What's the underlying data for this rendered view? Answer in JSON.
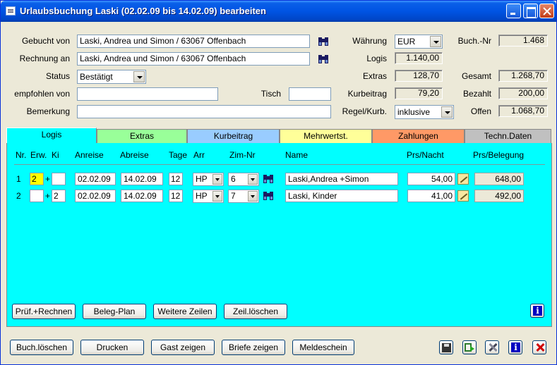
{
  "window": {
    "title": "Urlaubsbuchung Laski (02.02.09 bis 14.02.09) bearbeiten"
  },
  "form": {
    "gebucht_von_label": "Gebucht von",
    "gebucht_von_value": "Laski, Andrea und Simon / 63067 Offenbach",
    "rechnung_an_label": "Rechnung an",
    "rechnung_an_value": "Laski, Andrea und Simon / 63067 Offenbach",
    "status_label": "Status",
    "status_value": "Bestätigt",
    "empfohlen_label": "empfohlen von",
    "empfohlen_value": "",
    "tisch_label": "Tisch",
    "tisch_value": "",
    "bemerkung_label": "Bemerkung",
    "bemerkung_value": "",
    "waehrung_label": "Währung",
    "waehrung_value": "EUR",
    "logis_label": "Logis",
    "logis_value": "1.140,00",
    "extras_label": "Extras",
    "extras_value": "128,70",
    "kurbeitrag_label": "Kurbeitrag",
    "kurbeitrag_value": "79,20",
    "regel_label": "Regel/Kurb.",
    "regel_value": "inklusive",
    "buchnr_label": "Buch.-Nr",
    "buchnr_value": "1.468",
    "gesamt_label": "Gesamt",
    "gesamt_value": "1.268,70",
    "bezahlt_label": "Bezahlt",
    "bezahlt_value": "200,00",
    "offen_label": "Offen",
    "offen_value": "1.068,70"
  },
  "tabs": [
    {
      "label": "Logis",
      "color": "#00FFFF"
    },
    {
      "label": "Extras",
      "color": "#99FF99"
    },
    {
      "label": "Kurbeitrag",
      "color": "#99CCFF"
    },
    {
      "label": "Mehrwertst.",
      "color": "#FFFF99"
    },
    {
      "label": "Zahlungen",
      "color": "#FF9966"
    },
    {
      "label": "Techn.Daten",
      "color": "#C0C0C0"
    }
  ],
  "table": {
    "headers": {
      "nr": "Nr.",
      "erw": "Erw.",
      "ki": "Ki",
      "anreise": "Anreise",
      "abreise": "Abreise",
      "tage": "Tage",
      "arr": "Arr",
      "zimnr": "Zim-Nr",
      "name": "Name",
      "prs_nacht": "Prs/Nacht",
      "prs_belegung": "Prs/Belegung"
    },
    "rows": [
      {
        "nr": "1",
        "erw": "2",
        "plus": "+",
        "ki": "",
        "anreise": "02.02.09",
        "abreise": "14.02.09",
        "tage": "12",
        "arr": "HP",
        "zimnr": "6",
        "name": "Laski,Andrea +Simon",
        "prs_nacht": "54,00",
        "prs_belegung": "648,00"
      },
      {
        "nr": "2",
        "erw": "",
        "plus": "+",
        "ki": "2",
        "anreise": "02.02.09",
        "abreise": "14.02.09",
        "tage": "12",
        "arr": "HP",
        "zimnr": "7",
        "name": "Laski, Kinder",
        "prs_nacht": "41,00",
        "prs_belegung": "492,00"
      }
    ]
  },
  "panel_buttons": {
    "pruef": "Prüf.+Rechnen",
    "beleg": "Beleg-Plan",
    "weitere": "Weitere Zeilen",
    "zeil_loeschen": "Zeil.löschen"
  },
  "bottom_buttons": {
    "buch_loeschen": "Buch.löschen",
    "drucken": "Drucken",
    "gast_zeigen": "Gast zeigen",
    "briefe_zeigen": "Briefe zeigen",
    "meldeschein": "Meldeschein"
  },
  "info_glyph": "i"
}
